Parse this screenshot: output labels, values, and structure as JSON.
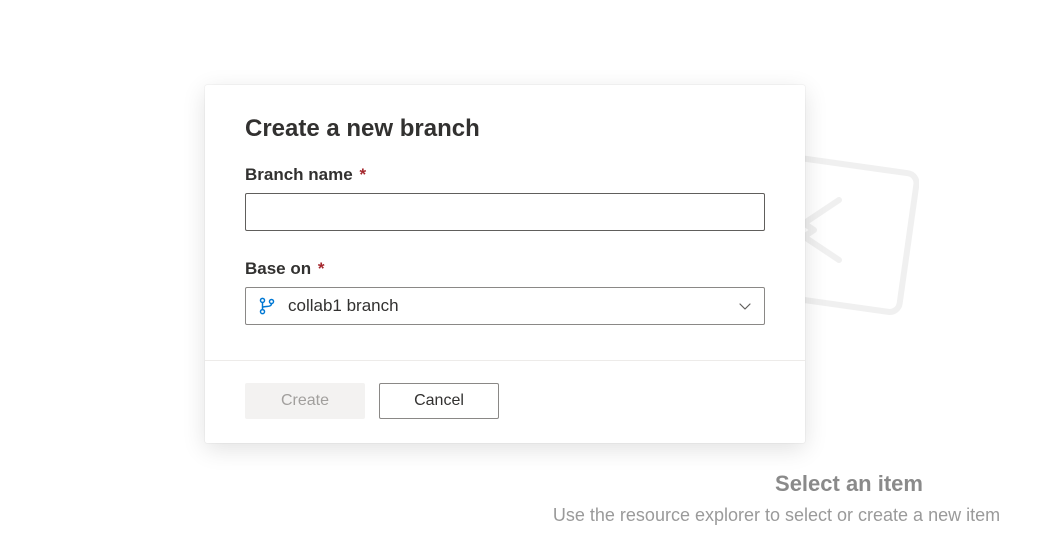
{
  "dialog": {
    "title": "Create a new branch",
    "branchName": {
      "label": "Branch name",
      "required": "*",
      "value": ""
    },
    "baseOn": {
      "label": "Base on",
      "required": "*",
      "selected": "collab1 branch"
    },
    "actions": {
      "create": "Create",
      "cancel": "Cancel"
    }
  },
  "background": {
    "title": "Select an item",
    "subtitle": "Use the resource explorer to select or create a new item"
  }
}
